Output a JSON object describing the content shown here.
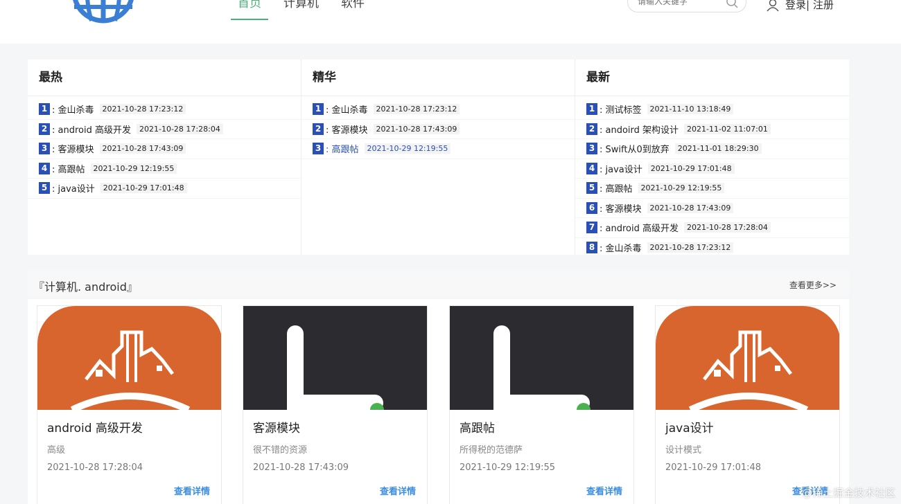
{
  "header": {
    "nav": [
      {
        "label": "首页"
      },
      {
        "label": "计算机"
      },
      {
        "label": "软件"
      }
    ],
    "search_placeholder": "请输入关键字",
    "login_label": "登录| 注册"
  },
  "panels": [
    {
      "title": "最热",
      "items": [
        {
          "num": "1",
          "title": ": 金山杀毒",
          "time": "2021-10-28 17:23:12"
        },
        {
          "num": "2",
          "title": ": android 高级开发",
          "time": "2021-10-28 17:28:04"
        },
        {
          "num": "3",
          "title": ": 客源模块",
          "time": "2021-10-28 17:43:09"
        },
        {
          "num": "4",
          "title": ": 高跟帖",
          "time": "2021-10-29 12:19:55"
        },
        {
          "num": "5",
          "title": ": java设计",
          "time": "2021-10-29 17:01:48"
        }
      ]
    },
    {
      "title": "精华",
      "items": [
        {
          "num": "1",
          "title": ": 金山杀毒",
          "time": "2021-10-28 17:23:12"
        },
        {
          "num": "2",
          "title": ": 客源模块",
          "time": "2021-10-28 17:43:09"
        },
        {
          "num": "3",
          "title": ": 高跟帖",
          "time": "2021-10-29 12:19:55"
        }
      ]
    },
    {
      "title": "最新",
      "items": [
        {
          "num": "1",
          "title": ": 测试标签",
          "time": "2021-11-10 13:18:49"
        },
        {
          "num": "2",
          "title": ": andoird 架构设计",
          "time": "2021-11-02 11:07:01"
        },
        {
          "num": "3",
          "title": ": Swift从0到放弃",
          "time": "2021-11-01 18:29:30"
        },
        {
          "num": "4",
          "title": ": java设计",
          "time": "2021-10-29 17:01:48"
        },
        {
          "num": "5",
          "title": ": 高跟帖",
          "time": "2021-10-29 12:19:55"
        },
        {
          "num": "6",
          "title": ": 客源模块",
          "time": "2021-10-28 17:43:09"
        },
        {
          "num": "7",
          "title": ": android 高级开发",
          "time": "2021-10-28 17:28:04"
        },
        {
          "num": "8",
          "title": ": 金山杀毒",
          "time": "2021-10-28 17:23:12"
        }
      ]
    }
  ],
  "section": {
    "title": "『计算机. android』",
    "more": "查看更多>>"
  },
  "cards": [
    {
      "image": "orange-building-icon",
      "title": "android 高级开发",
      "desc": "高级",
      "date": "2021-10-28 17:28:04",
      "link": "查看详情"
    },
    {
      "image": "dark-l-icon",
      "title": "客源模块",
      "desc": "很不错的资源",
      "date": "2021-10-28 17:43:09",
      "link": "查看详情"
    },
    {
      "image": "dark-l-icon",
      "title": "高跟帖",
      "desc": "所得税的范德萨",
      "date": "2021-10-29 12:19:55",
      "link": "查看详情"
    },
    {
      "image": "orange-building-icon",
      "title": "java设计",
      "desc": "设计模式",
      "date": "2021-10-29 17:01:48",
      "link": "查看详情"
    }
  ],
  "watermark": "@稀土掘金技术社区",
  "colors": {
    "accent_green": "#4caf7a",
    "rank_blue": "#2a4fb5",
    "link_blue": "#3b8ee0",
    "card_orange": "#d9652e"
  }
}
